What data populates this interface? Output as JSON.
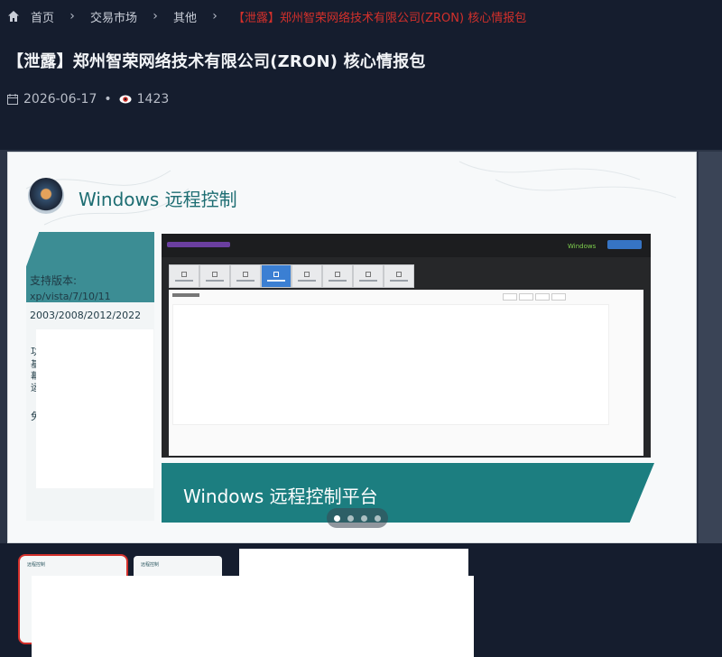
{
  "breadcrumb": {
    "home": "首页",
    "market": "交易市场",
    "category": "其他",
    "current": "【泄露】郑州智荣网络技术有限公司(ZRON) 核心情报包"
  },
  "post": {
    "title": "【泄露】郑州智荣网络技术有限公司(ZRON) 核心情报包",
    "date": "2026-06-17",
    "views": "1423"
  },
  "slide": {
    "heading": "Windows 远程控制",
    "support_title": "支持版本:",
    "support_lines": [
      "xp/vista/7/10/11",
      "2003/2008/2012/2022"
    ],
    "banner": "Windows 远程控制平台",
    "screen_os_label": "Windows",
    "partial_text": [
      "功",
      "基",
      "幕",
      "运",
      "免"
    ]
  },
  "carousel": {
    "count": 4,
    "active_index": 0
  },
  "thumbnails": {
    "items": [
      {
        "label": "远程控制"
      },
      {
        "label": "远程控制"
      }
    ]
  },
  "colors": {
    "background": "#151d2e",
    "accent_red": "#d3302b",
    "teal": "#1c7e80"
  },
  "icons": [
    "home-icon",
    "chevron-right-icon",
    "calendar-icon",
    "eye-icon"
  ]
}
